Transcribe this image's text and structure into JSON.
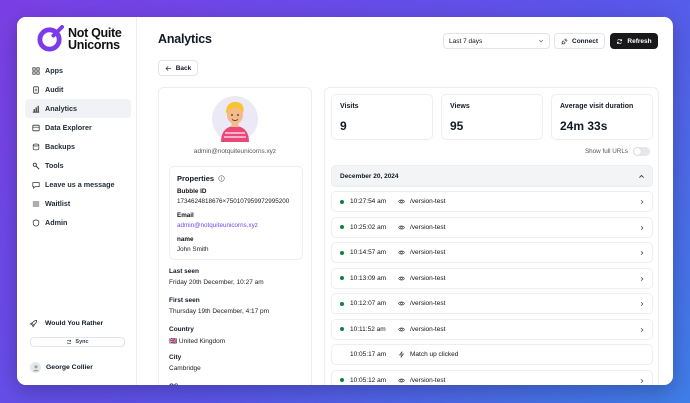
{
  "app": {
    "logo_line1": "Not Quite",
    "logo_line2": "Unicorns",
    "brand_color": "#7c3aed"
  },
  "sidebar": {
    "items": [
      {
        "label": "Apps",
        "icon": "grid-icon"
      },
      {
        "label": "Audit",
        "icon": "document-icon"
      },
      {
        "label": "Analytics",
        "icon": "bar-chart-icon",
        "active": true
      },
      {
        "label": "Data Explorer",
        "icon": "database-icon"
      },
      {
        "label": "Backups",
        "icon": "archive-icon"
      },
      {
        "label": "Tools",
        "icon": "tools-icon"
      },
      {
        "label": "Leave us a message",
        "icon": "message-icon"
      },
      {
        "label": "Waitlist",
        "icon": "list-icon"
      },
      {
        "label": "Admin",
        "icon": "shield-icon"
      }
    ],
    "project_name": "Would You Rather",
    "sync_label": "Sync",
    "user_name": "George Collier"
  },
  "header": {
    "title": "Analytics",
    "range_selected": "Last 7 days",
    "connect_label": "Connect",
    "refresh_label": "Refresh",
    "back_label": "Back"
  },
  "user_panel": {
    "email": "admin@notquiteunicorns.xyz",
    "properties_title": "Properties",
    "properties": [
      {
        "label": "Bubble ID",
        "value": "1734624818676×750107959972995200"
      },
      {
        "label": "Email",
        "value": "admin@notquiteunicorns.xyz"
      },
      {
        "label": "name",
        "value": "John Smith"
      }
    ],
    "fields": [
      {
        "label": "Last seen",
        "value": "Friday 20th December, 10:27 am"
      },
      {
        "label": "First seen",
        "value": "Thursday 19th December, 4:17 pm"
      },
      {
        "label": "Country",
        "value": "🇬🇧 United Kingdom"
      },
      {
        "label": "City",
        "value": "Cambridge"
      },
      {
        "label": "OS",
        "value": ""
      }
    ]
  },
  "stats": [
    {
      "label": "Visits",
      "value": "9"
    },
    {
      "label": "Views",
      "value": "95"
    },
    {
      "label": "Average visit duration",
      "value": "24m 33s"
    }
  ],
  "show_full_urls_label": "Show full URLs",
  "show_full_urls_on": false,
  "visits": {
    "date": "December 20, 2024",
    "rows": [
      {
        "time": "10:27:54 am",
        "type": "view",
        "text": "/version-test",
        "live": true
      },
      {
        "time": "10:25:02 am",
        "type": "view",
        "text": "/version-test",
        "live": true
      },
      {
        "time": "10:14:57 am",
        "type": "view",
        "text": "/version-test",
        "live": true
      },
      {
        "time": "10:13:09 am",
        "type": "view",
        "text": "/version-test",
        "live": true
      },
      {
        "time": "10:12:07 am",
        "type": "view",
        "text": "/version-test",
        "live": true
      },
      {
        "time": "10:11:52 am",
        "type": "view",
        "text": "/version-test",
        "live": true
      },
      {
        "time": "10:05:17 am",
        "type": "event",
        "text": "Match up clicked",
        "live": false
      },
      {
        "time": "10:05:12 am",
        "type": "view",
        "text": "/version-test",
        "live": true
      }
    ]
  }
}
